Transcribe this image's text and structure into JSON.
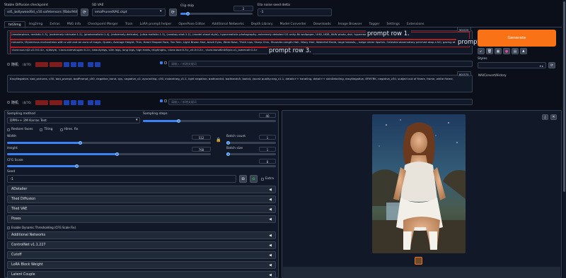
{
  "top": {
    "checkpoint_label": "Stable Diffusion checkpoint",
    "checkpoint_value": "sd1_bollywoodSd_v10.safetensors [6bbc9440b0]",
    "vae_label": "SD VAE",
    "vae_value": "emaPrunedVAE.ckpt",
    "clip_label": "Clip skip",
    "clip_value": "2",
    "eta_label": "Eta noise seed delta",
    "eta_value": "-1"
  },
  "tabs": [
    "txt2img",
    "img2img",
    "Extras",
    "PNG Info",
    "Checkpoint Merger",
    "Train",
    "LoRA prompt helper",
    "OpenPose Editor",
    "Additional Networks",
    "Depth Library",
    "Model Converter",
    "Downloads",
    "Image Browser",
    "Tagger",
    "Settings",
    "Extensions"
  ],
  "prompt": {
    "row1": "(masterpiece, realistic:1.3), (extremely intricate:1.2), (photorealistic:1.4), (extremely delicate), (ultra realistic:1.3), (cowboy shot:1.2), (model shoot style), hyperrealistic photography, extremely detailed CG unity 8k wallpaper, UHD, HDR, 8kW photo, dslr, hyperrealistic 3d render,",
    "row2": "romantic, Mysterious enchantress with a veil and an aura of magic, Queen, Average Height, Thin, Heart Shaped Face, Tan Skin, Light Brown Hair, black Eyes, Wide Nose, Thick Lips, Sharp Chin, Shoulder-Length Hair, Wavy Hair, Waterfall Braid, large breasts,,, beige sheer lipstick, Celestial observatory perched atop a hill, gazing at the starry night sky,",
    "row3": "<lora:sxz-nlj2-v2.0:0.4>, n(dstyle, <lora:animeLsgen:0.2>, beautylegs, slim legs, long legs, high heels, thighhighs, <lora:lace:0.3>_v0.0:0.2>, <lora:kondKinkStyle-v1_lowrecall:0.4>",
    "counter": "90/225",
    "annot1": "prompt row 1.",
    "annot2": "prompt row 2.",
    "annot3": "prompt row 3."
  },
  "neg_prompt": {
    "text": "EasyNegative, bad_pictures, v30, bad_prompt, badPrompt_v00, negative_hand, ays, negative_v2, ayscrolling, v30, instantneg_v1.1, light negative, badhandv4, badhandv5, badv4, (worst quality:neg_v1.1, details++ handling, detail++ skinDetailing, easyNegative, 8FM7RK, negative_v30, subject out of frame, frame, white frame,",
    "counter": "80/375"
  },
  "wildcard_label": "随机",
  "wildcard_count": "(8/76)",
  "wildcard_count2": "(8/76)",
  "wildcard_placeholder": "请输入 / 新增关键词",
  "generate": "Generate",
  "styles_label": "Styles",
  "network_label": "NAI/Convert/History",
  "sampling": {
    "method_label": "Sampling method",
    "method_value": "DPM++ 2M Karras Test",
    "steps_label": "Sampling steps",
    "steps_value": "40",
    "steps_fraction": 0.27
  },
  "options": [
    "Restore faces",
    "Tiling",
    "Hires. fix"
  ],
  "width": {
    "label": "Width",
    "value": "512",
    "fraction": 0.36
  },
  "height": {
    "label": "Height",
    "value": "768",
    "fraction": 0.54
  },
  "batch_count": {
    "label": "Batch count",
    "value": "1",
    "fraction": 0.0
  },
  "batch_size": {
    "label": "Batch size",
    "value": "1",
    "fraction": 0.0
  },
  "cfg": {
    "label": "CFG Scale",
    "value": "8",
    "fraction": 0.26
  },
  "seed": {
    "label": "Seed",
    "value": "-1",
    "extra_label": "Extra"
  },
  "accordions": [
    "ADetailer",
    "Tiled Diffusion",
    "Tiled VAE",
    "Poses"
  ],
  "dynamic_label": "Enable Dynamic Thresholding (CFG Scale Fix)",
  "accordions2": [
    "Additional Networks",
    "ControlNet v1.1.227",
    "Cutoff",
    "LoRA Block Weight",
    "Latent Couple"
  ],
  "colors": {
    "bg": "#0b0f19",
    "accent": "#f97316",
    "primary": "#3b82f6"
  }
}
